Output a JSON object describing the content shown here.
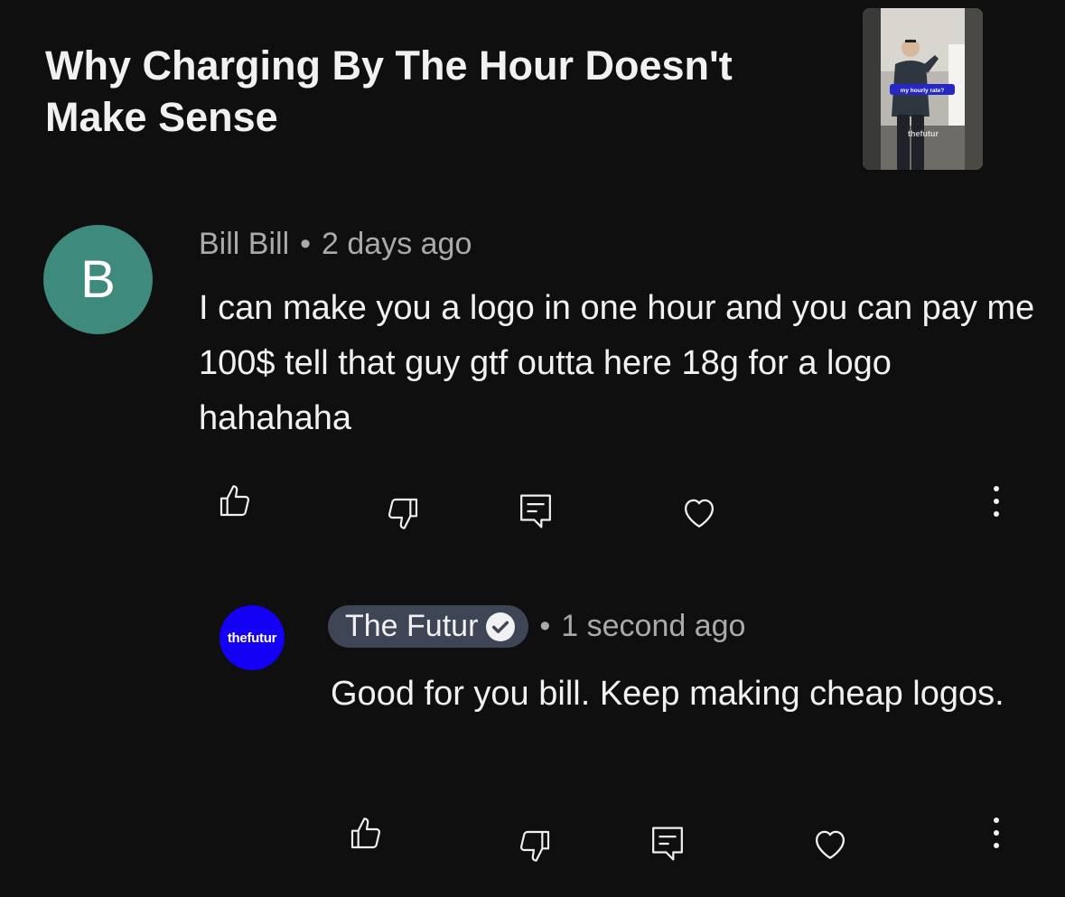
{
  "video": {
    "title": "Why Charging By The Hour Doesn't Make Sense",
    "thumbnail": {
      "caption": "my hourly rate?",
      "watermark": "thefutur"
    }
  },
  "comment": {
    "avatar_letter": "B",
    "avatar_color": "#3e8a7c",
    "author": "Bill Bill",
    "separator": "•",
    "time": "2 days ago",
    "text": "I can make you a logo in one hour and you can pay me 100$ tell that guy gtf outta here 18g for a logo hahahaha"
  },
  "reply": {
    "avatar_text": "thefutur",
    "avatar_color": "#1400f5",
    "author": "The Futur",
    "separator": "•",
    "time": "1 second ago",
    "text": "Good for you bill. Keep making cheap logos.",
    "author_pill_color": "#3e4656"
  },
  "actions": {
    "icons": [
      "thumb-up-icon",
      "thumb-down-icon",
      "reply-icon",
      "heart-icon",
      "more-vert-icon"
    ]
  }
}
